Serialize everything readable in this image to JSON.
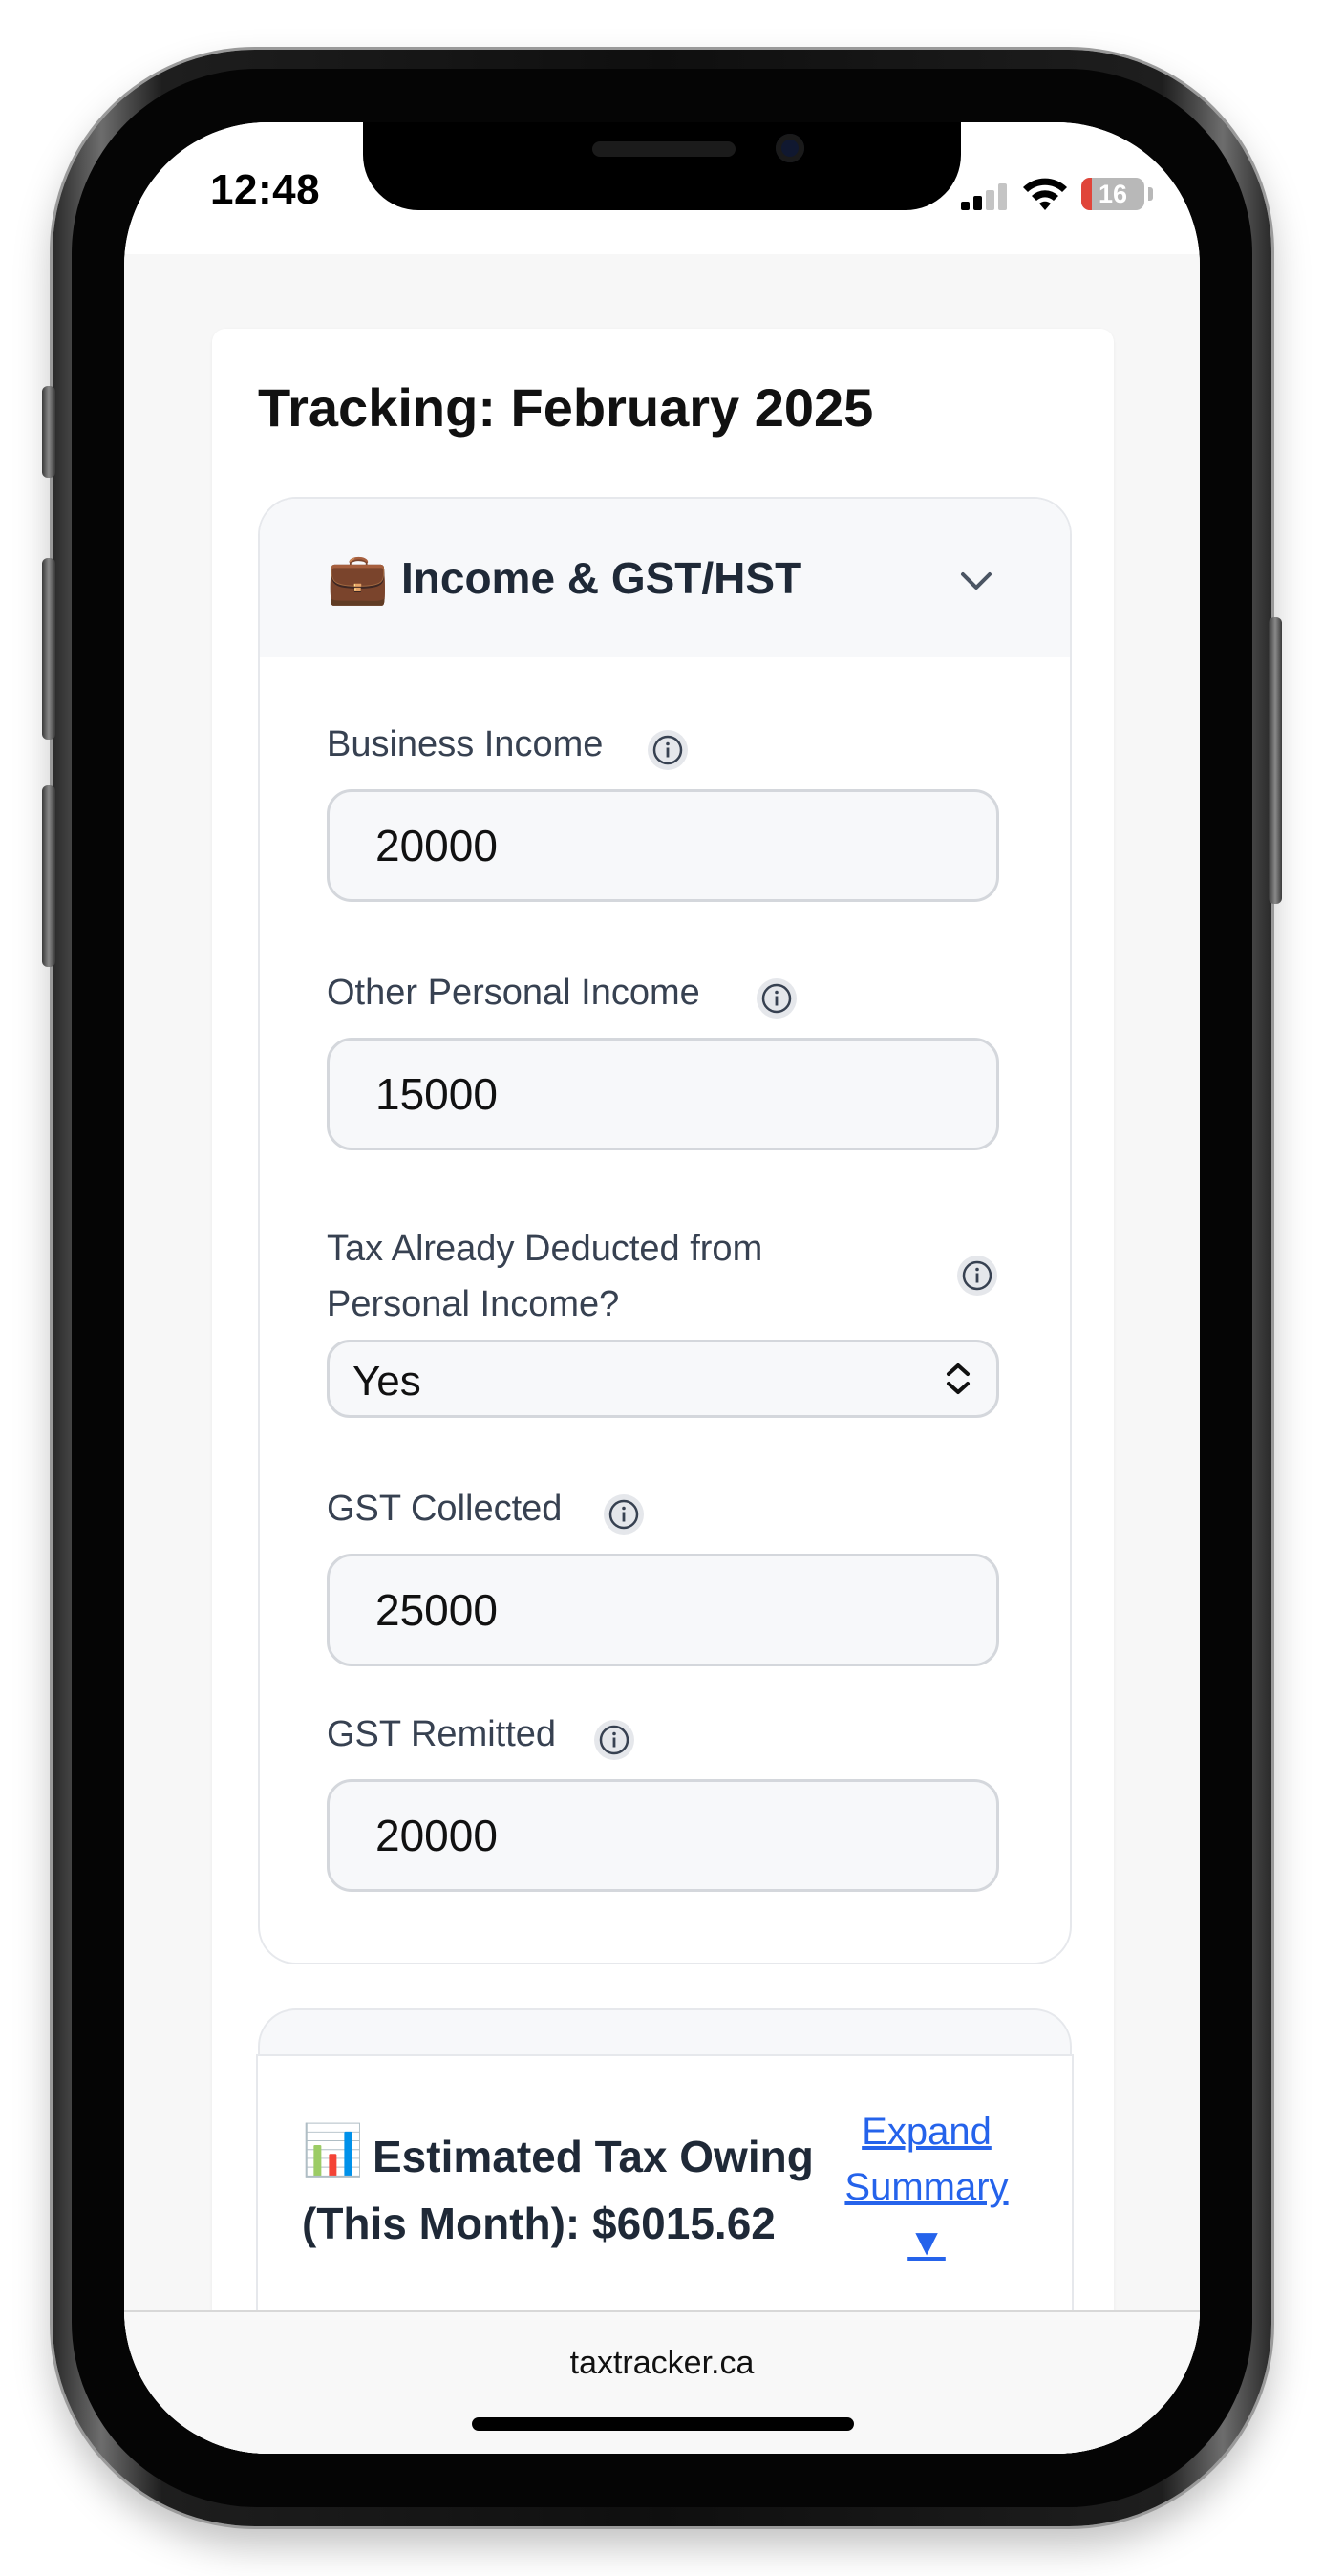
{
  "status_bar": {
    "time": "12:48",
    "battery": "16",
    "battery_level": 0.16,
    "icons": [
      "signal-icon",
      "wifi-icon",
      "battery-icon"
    ]
  },
  "page": {
    "title": "Tracking: February 2025",
    "income_section": {
      "emoji": "💼",
      "title": "Income & GST/HST",
      "expanded": true,
      "fields": {
        "business_income": {
          "label": "Business Income",
          "value": "20000"
        },
        "other_personal_income": {
          "label": "Other Personal Income",
          "value": "15000"
        },
        "tax_deducted": {
          "label": "Tax Already Deducted from Personal Income?",
          "value": "Yes"
        },
        "gst_collected": {
          "label": "GST Collected",
          "value": "25000"
        },
        "gst_remitted": {
          "label": "GST Remitted",
          "value": "20000"
        }
      }
    },
    "summary_section": {
      "emoji": "📊",
      "title": "Estimated Tax Owing (This Month): $6015.62",
      "expand_link": "Expand Summary ▼"
    }
  },
  "browser": {
    "url": "taxtracker.ca"
  },
  "colors": {
    "accent_link": "#2563eb",
    "page_background": "#f7f7f7",
    "input_border": "#d4d7dc"
  }
}
